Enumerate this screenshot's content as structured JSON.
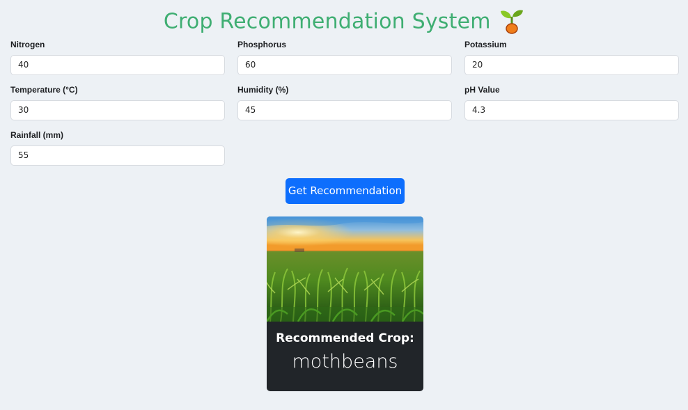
{
  "header": {
    "title": "Crop Recommendation System",
    "icon": "seedling-icon",
    "title_color": "#3fae72"
  },
  "form": {
    "nitrogen": {
      "label": "Nitrogen",
      "value": "40"
    },
    "phosphorus": {
      "label": "Phosphorus",
      "value": "60"
    },
    "potassium": {
      "label": "Potassium",
      "value": "20"
    },
    "temperature": {
      "label": "Temperature (°C)",
      "value": "30"
    },
    "humidity": {
      "label": "Humidity (%)",
      "value": "45"
    },
    "ph": {
      "label": "pH Value",
      "value": "4.3"
    },
    "rainfall": {
      "label": "Rainfall (mm)",
      "value": "55"
    },
    "submit_label": "Get Recommendation",
    "button_color": "#0d6efd"
  },
  "result": {
    "heading": "Recommended Crop:",
    "crop": "mothbeans",
    "image": "corn-field-sunset-image"
  }
}
